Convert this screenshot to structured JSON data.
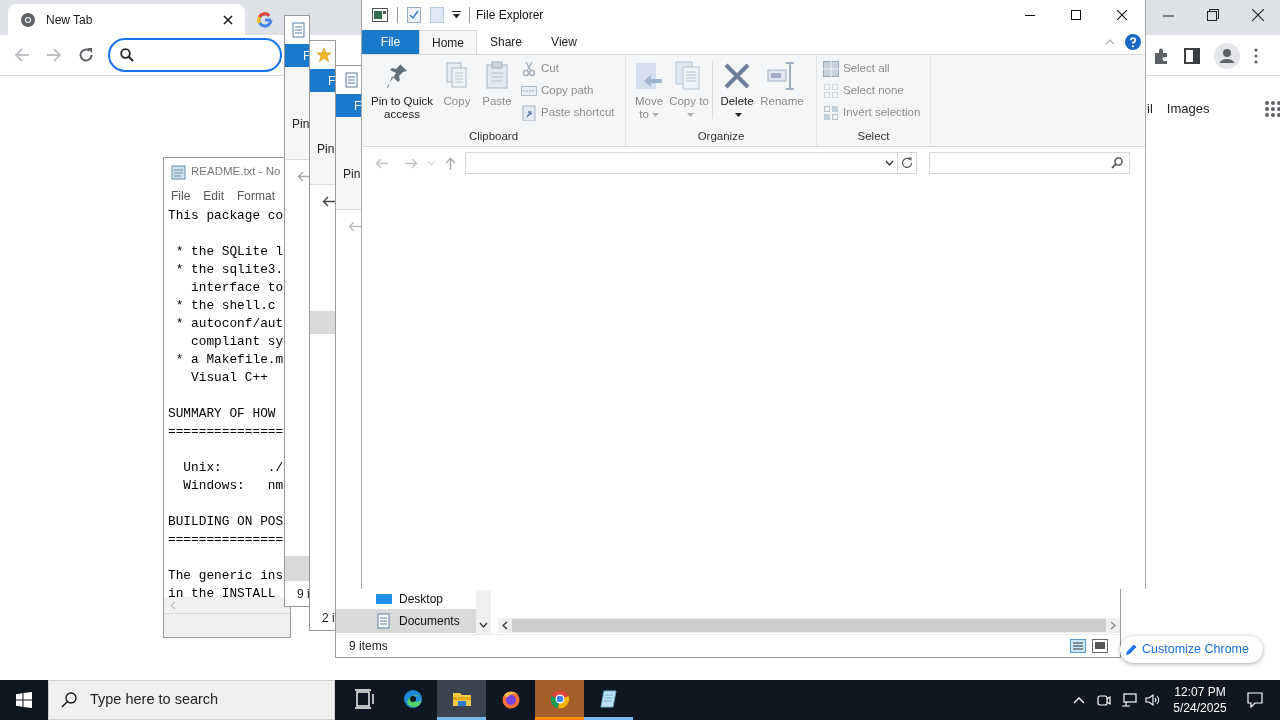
{
  "chrome": {
    "tabs": [
      {
        "kind": "newtab",
        "label": "New Tab",
        "selected": true
      },
      {
        "kind": "google",
        "selected": false
      }
    ],
    "links": [
      "il",
      "Images"
    ],
    "customize_button": "Customize Chrome"
  },
  "notepad": {
    "title": "README.txt - No",
    "menu": [
      "File",
      "Edit",
      "Format"
    ],
    "paragraphs": [
      [
        "This package co"
      ],
      [
        " * the SQLite l",
        " * the sqlite3.",
        "   interface to",
        " * the shell.c",
        " * autoconf/aut",
        "   compliant sy",
        " * a Makefile.m",
        "   Visual C++"
      ],
      [
        "SUMMARY OF HOW",
        "==============="
      ],
      [
        "  Unix:      ./",
        "  Windows:   nm"
      ],
      [
        "BUILDING ON POS",
        "==============="
      ],
      [
        "The generic ins",
        "in the INSTALL"
      ]
    ]
  },
  "stacked_windows": [
    {
      "kind": "document",
      "file_tab": "F",
      "ribbon_text": "Pin",
      "status": "9 i"
    },
    {
      "kind": "star",
      "file_tab": "F",
      "ribbon_text": "Pin",
      "status": "2 i"
    }
  ],
  "explorer_back": {
    "file_tab": "F",
    "ribbon_text": "Pin",
    "nav_items": [
      {
        "kind": "desktop",
        "label": "Desktop",
        "selected": false
      },
      {
        "kind": "documents",
        "label": "Documents",
        "selected": true
      }
    ],
    "status": "9 items"
  },
  "explorer": {
    "title": "File Explorer",
    "file_menu": "File",
    "tabs": [
      {
        "label": "Home",
        "selected": true
      },
      {
        "label": "Share",
        "selected": false
      },
      {
        "label": "View",
        "selected": false
      }
    ],
    "groups": [
      {
        "label": "Clipboard",
        "items": [
          {
            "kind": "large",
            "label": "Pin to Quick access",
            "disabled": false
          },
          {
            "kind": "large",
            "label": "Copy",
            "disabled": true
          },
          {
            "kind": "large",
            "label": "Paste",
            "disabled": true
          },
          {
            "kind": "small",
            "label": "Cut",
            "disabled": true
          },
          {
            "kind": "small",
            "label": "Copy path",
            "disabled": true
          },
          {
            "kind": "small",
            "label": "Paste shortcut",
            "disabled": true
          }
        ]
      },
      {
        "label": "Organize",
        "items": [
          {
            "kind": "large",
            "label": "Move to",
            "disabled": true,
            "dropdown": true
          },
          {
            "kind": "large",
            "label": "Copy to",
            "disabled": true,
            "dropdown": true
          },
          {
            "kind": "large",
            "label": "Delete",
            "disabled": false,
            "dropdown": true
          },
          {
            "kind": "large",
            "label": "Rename",
            "disabled": true
          }
        ]
      },
      {
        "label": "Select",
        "items": [
          {
            "kind": "small",
            "label": "Select all",
            "disabled": true
          },
          {
            "kind": "small",
            "label": "Select none",
            "disabled": true
          },
          {
            "kind": "small",
            "label": "Invert selection",
            "disabled": true
          }
        ]
      }
    ]
  },
  "taskbar": {
    "search_placeholder": "Type here to search",
    "apps": [
      {
        "kind": "taskview",
        "running": false,
        "active": false,
        "flashing": false
      },
      {
        "kind": "edge",
        "running": false,
        "active": false,
        "flashing": false
      },
      {
        "kind": "explorer",
        "running": true,
        "active": true,
        "flashing": false
      },
      {
        "kind": "firefox",
        "running": false,
        "active": false,
        "flashing": false
      },
      {
        "kind": "chrome",
        "running": true,
        "active": false,
        "flashing": true
      },
      {
        "kind": "notepad",
        "running": true,
        "active": false,
        "flashing": false
      }
    ],
    "time": "12:07 PM",
    "date": "5/24/2025"
  }
}
